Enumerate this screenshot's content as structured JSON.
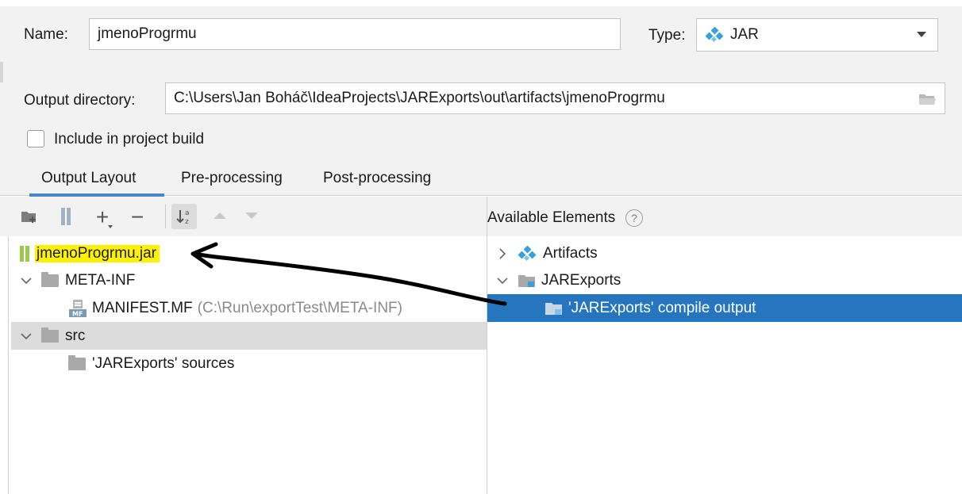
{
  "form": {
    "name_label": "Name:",
    "name_value": "jmenoProgrmu",
    "type_label": "Type:",
    "type_value": "JAR",
    "output_dir_label": "Output directory:",
    "output_dir_value": "C:\\Users\\Jan Boháč\\IdeaProjects\\JARExports\\out\\artifacts\\jmenoProgrmu",
    "include_build_label": "Include in project build",
    "include_build_checked": false
  },
  "tabs": [
    {
      "label": "Output Layout",
      "active": true
    },
    {
      "label": "Pre-processing",
      "active": false
    },
    {
      "label": "Post-processing",
      "active": false
    }
  ],
  "toolbar": {
    "icons": [
      "add-directory-icon",
      "add-archive-icon",
      "add-icon",
      "remove-icon",
      "sort-alpha-icon",
      "move-up-icon",
      "move-down-icon"
    ],
    "plus_glyph": "+",
    "minus_glyph": "−"
  },
  "layout_tree": {
    "jar_name": "jmenoProgrmu.jar",
    "meta_inf": "META-INF",
    "manifest_name": "MANIFEST.MF",
    "manifest_path": "(C:\\Run\\exportTest\\META-INF)",
    "src": "src",
    "sources": "'JARExports' sources"
  },
  "available": {
    "header": "Available Elements",
    "help_glyph": "?",
    "artifacts": "Artifacts",
    "project": "JARExports",
    "compile_output": "'JARExports' compile output"
  },
  "colors": {
    "selection": "#2675bf",
    "highlight": "#fff200",
    "tab_underline": "#4a86c7",
    "artifact_icon": "#3aa0d8"
  }
}
